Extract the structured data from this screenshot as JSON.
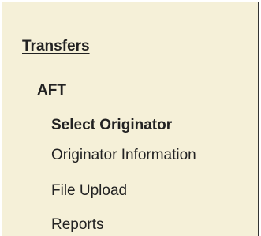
{
  "nav": {
    "section_title": "Transfers",
    "group_title": "AFT",
    "items": [
      {
        "label": "Select Originator",
        "selected": true
      },
      {
        "label": "Originator Information",
        "selected": false
      },
      {
        "label": "File Upload",
        "selected": false
      },
      {
        "label": "Reports",
        "selected": false
      }
    ]
  },
  "colors": {
    "panel_background": "#f5f0d8",
    "text": "#222222"
  }
}
